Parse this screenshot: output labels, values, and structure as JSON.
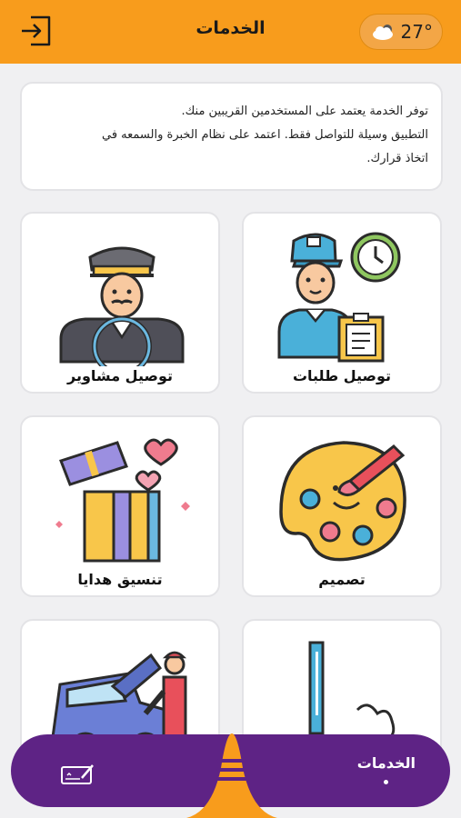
{
  "header": {
    "title": "الخدمات",
    "temperature": "27°",
    "weather_icon": "cloud-icon",
    "exit_icon": "logout-icon",
    "bg_color": "#f89c1c"
  },
  "notice": {
    "line1": "توفر الخدمة يعتمد على المستخدمين القريبين منك.",
    "line2": "التطبيق وسيلة للتواصل فقط. اعتمد على نظام الخبرة والسمعه في",
    "line3": "اتخاذ قرارك."
  },
  "services": [
    {
      "label": "توصيل طلبات",
      "icon": "delivery-person-icon"
    },
    {
      "label": "توصيل مشاوير",
      "icon": "driver-icon"
    },
    {
      "label": "تصميم",
      "icon": "palette-icon"
    },
    {
      "label": "تنسيق هدايا",
      "icon": "gift-icon"
    },
    {
      "label": "",
      "icon": "cleaning-mop-icon"
    },
    {
      "label": "",
      "icon": "car-mechanic-icon"
    }
  ],
  "bottom_nav": {
    "active_label": "الخدمات",
    "menu_icon": "hamburger-icon",
    "signature_icon": "signature-icon",
    "bar_color": "#5e2385"
  }
}
